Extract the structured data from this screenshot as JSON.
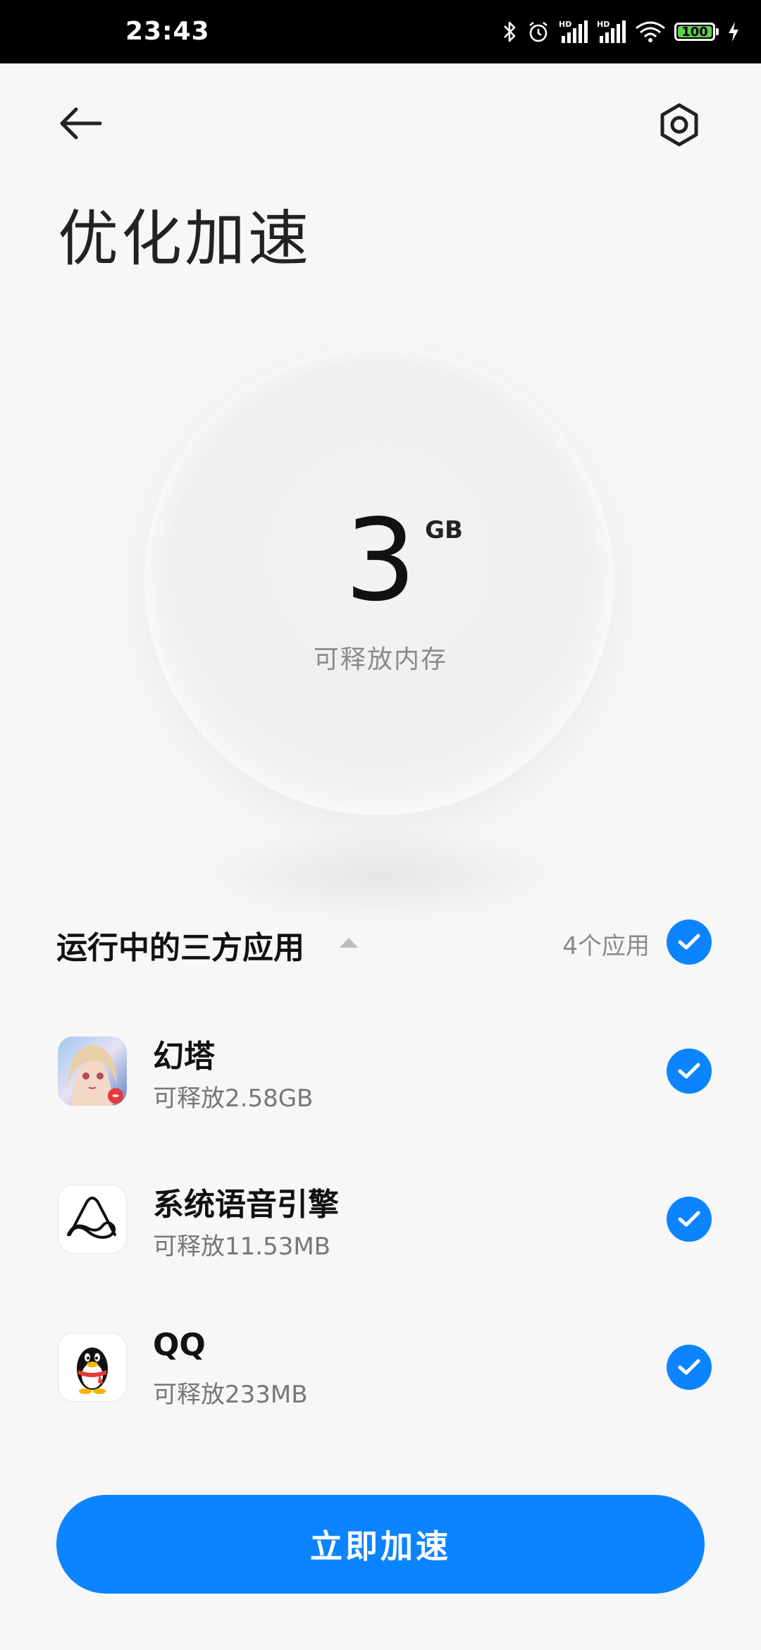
{
  "status_bar": {
    "time": "23:43",
    "icons": [
      "bluetooth-icon",
      "alarm-icon",
      "signal-hd-icon",
      "signal-hd-icon",
      "wifi-icon",
      "battery-icon",
      "charging-icon"
    ],
    "signal_tag": "HD",
    "battery_level": "100"
  },
  "header": {
    "back_icon": "arrow-left-icon",
    "settings_icon": "hexagon-settings-icon",
    "title": "优化加速"
  },
  "memory": {
    "value": "3",
    "unit": "GB",
    "label": "可释放内存"
  },
  "section": {
    "title": "运行中的三方应用",
    "caret_icon": "caret-up-icon",
    "count": "4个应用",
    "all_checked": true
  },
  "apps": [
    {
      "name": "幻塔",
      "size": "可释放2.58GB",
      "icon": "tower-of-fantasy-app-icon",
      "checked": true
    },
    {
      "name": "系统语音引擎",
      "size": "可释放11.53MB",
      "icon": "voice-engine-app-icon",
      "checked": true
    },
    {
      "name": "QQ",
      "size": "可释放233MB",
      "icon": "qq-penguin-app-icon",
      "checked": true
    }
  ],
  "action": {
    "boost_label": "立即加速"
  },
  "colors": {
    "accent": "#0d84ff",
    "background": "#f7f7f7",
    "status_bar": "#000000",
    "battery_fill": "#5fd04a"
  }
}
